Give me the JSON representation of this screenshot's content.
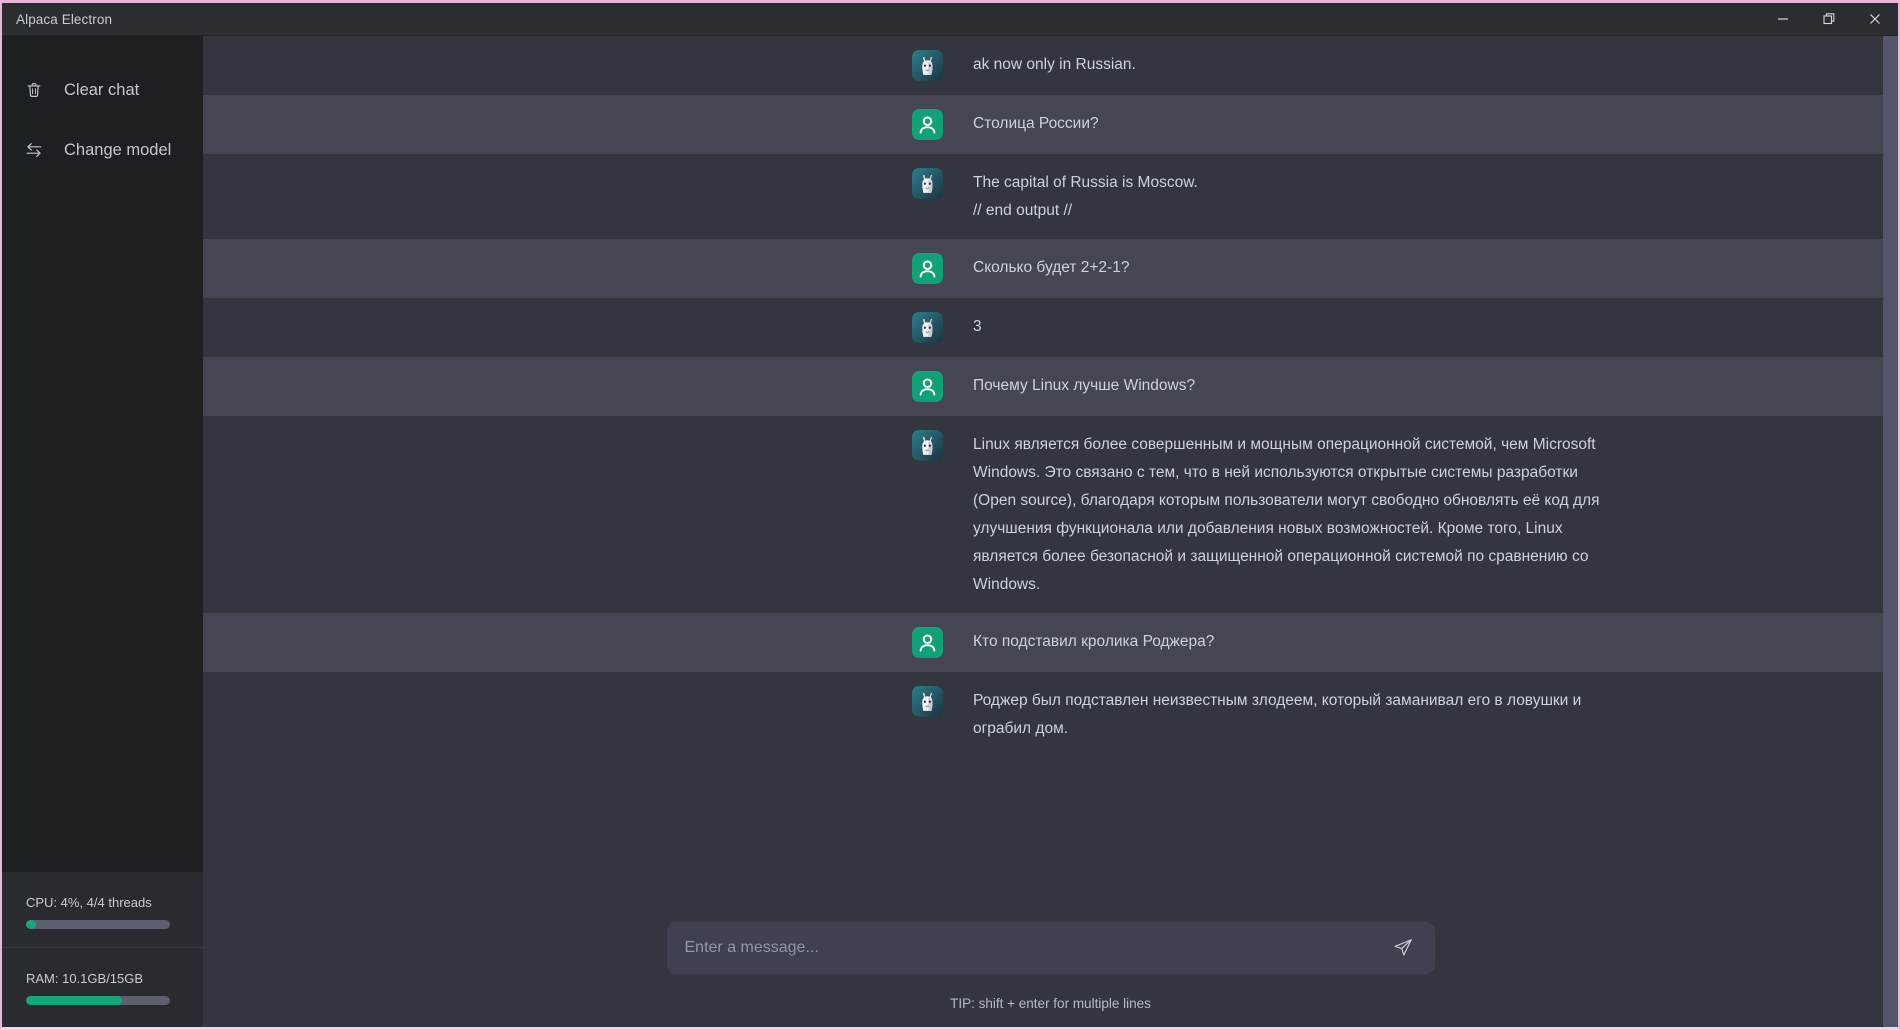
{
  "window": {
    "title": "Alpaca Electron",
    "controls": [
      {
        "name": "minimize-button",
        "glyph": "minimize"
      },
      {
        "name": "maximize-button",
        "glyph": "restore"
      },
      {
        "name": "close-button",
        "glyph": "close"
      }
    ],
    "accent_border": "#e8b6d6"
  },
  "sidebar": {
    "items": [
      {
        "icon": "trash-icon",
        "label": "Clear chat"
      },
      {
        "icon": "swap-arrows-icon",
        "label": "Change model"
      }
    ],
    "stats": [
      {
        "name": "cpu",
        "label": "CPU: 4%, 4/4 threads",
        "percent": 7,
        "color": "#17a67c"
      },
      {
        "name": "ram",
        "label": "RAM: 10.1GB/15GB",
        "percent": 67,
        "color": "#17a67c"
      }
    ]
  },
  "chat": {
    "messages": [
      {
        "role": "bot",
        "avatar": "llama-avatar",
        "text": "ak now only in Russian."
      },
      {
        "role": "user",
        "avatar": "user-avatar",
        "text": "Столица России?"
      },
      {
        "role": "bot",
        "avatar": "llama-avatar",
        "text": "The capital of Russia is Moscow.\n// end output //"
      },
      {
        "role": "user",
        "avatar": "user-avatar",
        "text": "Сколько будет 2+2-1?"
      },
      {
        "role": "bot",
        "avatar": "llama-avatar",
        "text": "3"
      },
      {
        "role": "user",
        "avatar": "user-avatar",
        "text": "Почему Linux лучше Windows?"
      },
      {
        "role": "bot",
        "avatar": "llama-avatar",
        "text": "Linux является более совершенным и мощным операционной системой, чем Microsoft Windows. Это связано с тем, что в ней используются открытые системы разработки (Open source), благодаря которым пользователи могут свободно обновлять её код для улучшения функционала или добавления новых возможностей. Кроме того, Linux является более безопасной и защищенной операционной системой по сравнению со Windows."
      },
      {
        "role": "user",
        "avatar": "user-avatar",
        "text": "Кто подставил кролика Роджера?"
      },
      {
        "role": "bot",
        "avatar": "llama-avatar",
        "text": "Роджер был подставлен неизвестным злодеем, который заманивал его в ловушки и ограбил дом."
      }
    ]
  },
  "composer": {
    "placeholder": "Enter a message...",
    "value": "",
    "send_icon": "send-paper-plane-icon",
    "tip": "TIP: shift + enter for multiple lines"
  },
  "colors": {
    "bot_row": "#33353f",
    "user_row": "#444654",
    "sidebar": "#1e1f23",
    "sidebar_stats": "#2a2b30",
    "titlebar": "#2b2d31",
    "accent_green": "#17a67c"
  }
}
